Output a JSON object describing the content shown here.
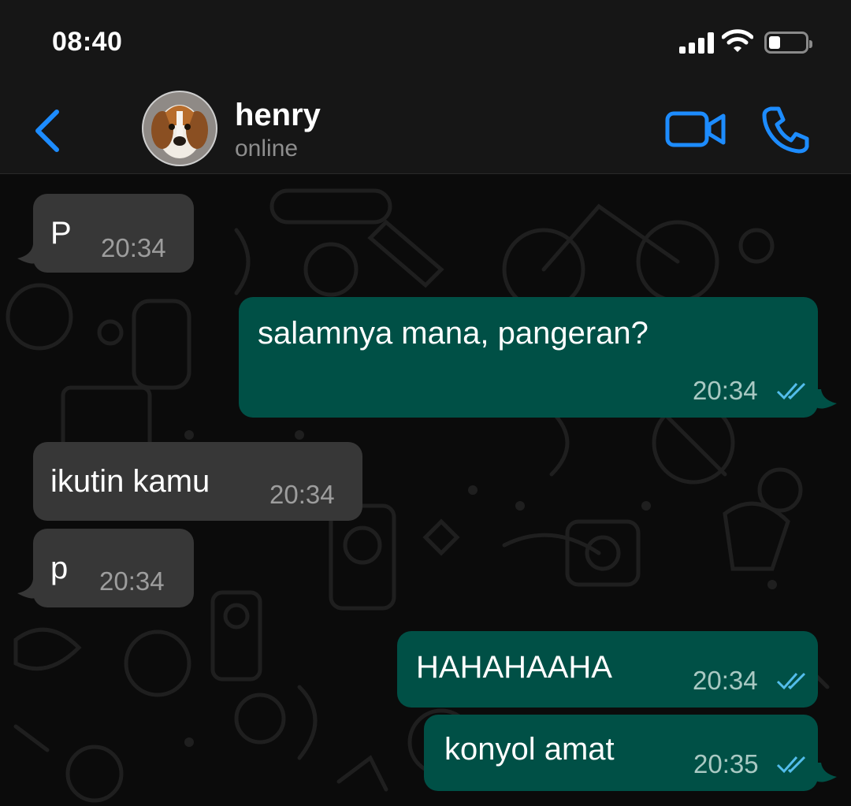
{
  "status_bar": {
    "time": "08:40"
  },
  "header": {
    "contact_name": "henry",
    "contact_status": "online",
    "accent": "#1d8cff"
  },
  "messages": [
    {
      "direction": "in",
      "text": "P",
      "time": "20:34"
    },
    {
      "direction": "out",
      "text": "salamnya mana, pangeran?",
      "time": "20:34",
      "read": true
    },
    {
      "direction": "in",
      "text": "ikutin kamu",
      "time": "20:34"
    },
    {
      "direction": "in",
      "text": "p",
      "time": "20:34"
    },
    {
      "direction": "out",
      "text": "HAHAHAAHA",
      "time": "20:34",
      "read": true
    },
    {
      "direction": "out",
      "text": "konyol amat",
      "time": "20:35",
      "read": true
    }
  ],
  "colors": {
    "incoming_bubble": "#373737",
    "outgoing_bubble": "#005046",
    "read_ticks": "#53bdeb"
  },
  "icons": [
    "back-icon",
    "video-call-icon",
    "phone-call-icon",
    "signal-icon",
    "wifi-icon",
    "battery-icon"
  ]
}
